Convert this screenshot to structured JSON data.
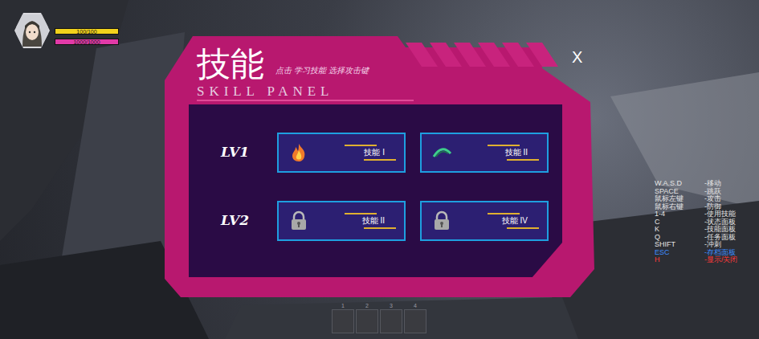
{
  "hud": {
    "hp": {
      "reading": "100/100",
      "level": 1
    },
    "mp": {
      "reading": "1000/1000",
      "level": 1
    }
  },
  "panel": {
    "title": "技能",
    "hint": "点击 学习技能 选择攻击键",
    "title_en": "SKILL PANEL",
    "close": "X",
    "tiers": [
      {
        "label": "LV1",
        "skills": [
          {
            "name": "技能 I",
            "kind": "fire"
          },
          {
            "name": "技能 II",
            "kind": "arc"
          }
        ]
      },
      {
        "label": "LV2",
        "skills": [
          {
            "name": "技能 II",
            "kind": "lock"
          },
          {
            "name": "技能 IV",
            "kind": "lock"
          }
        ]
      }
    ]
  },
  "controls": [
    {
      "key": "W.A.S.D",
      "action": "-移动",
      "color": "#e6e6e6"
    },
    {
      "key": "SPACE",
      "action": "-跳跃",
      "color": "#e6e6e6"
    },
    {
      "key": "鼠标左键",
      "action": "-攻击",
      "color": "#e6e6e6"
    },
    {
      "key": "鼠标右键",
      "action": "-防御",
      "color": "#e6e6e6"
    },
    {
      "key": "1-4",
      "action": "-使用技能",
      "color": "#e6e6e6"
    },
    {
      "key": "C",
      "action": "-状态面板",
      "color": "#e6e6e6"
    },
    {
      "key": "K",
      "action": "-技能面板",
      "color": "#e6e6e6"
    },
    {
      "key": "Q",
      "action": "-任务面板",
      "color": "#e6e6e6"
    },
    {
      "key": "SHIFT",
      "action": "-冲刺",
      "color": "#e6e6e6"
    },
    {
      "key": "ESC",
      "action": "-存档面板",
      "color": "#3d8dff"
    },
    {
      "key": "H",
      "action": "-显示/关闭",
      "color": "#ff3a3a"
    }
  ],
  "hotbar": [
    {
      "key": "1"
    },
    {
      "key": "2"
    },
    {
      "key": "3"
    },
    {
      "key": "4"
    }
  ]
}
